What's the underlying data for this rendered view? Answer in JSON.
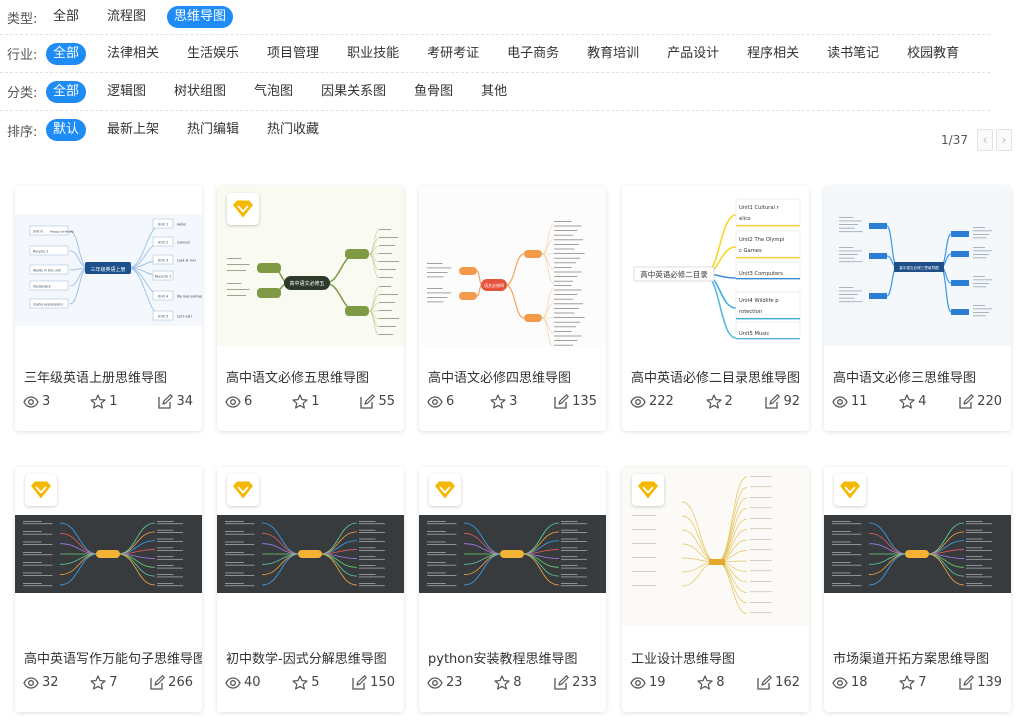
{
  "filters": {
    "type": {
      "label": "类型:",
      "options": [
        "全部",
        "流程图",
        "思维导图"
      ],
      "active": 2
    },
    "industry": {
      "label": "行业:",
      "options": [
        "全部",
        "法律相关",
        "生活娱乐",
        "项目管理",
        "职业技能",
        "考研考证",
        "电子商务",
        "教育培训",
        "产品设计",
        "程序相关",
        "读书笔记",
        "校园教育"
      ],
      "active": 0
    },
    "category": {
      "label": "分类:",
      "options": [
        "全部",
        "逻辑图",
        "树状组图",
        "气泡图",
        "因果关系图",
        "鱼骨图",
        "其他"
      ],
      "active": 0
    },
    "sort": {
      "label": "排序:",
      "options": [
        "默认",
        "最新上架",
        "热门编辑",
        "热门收藏"
      ],
      "active": 0
    }
  },
  "pager": {
    "text": "1/37",
    "prev": "‹",
    "next": "›"
  },
  "colors": {
    "accent": "#1f8cf5",
    "badge": "#f5b800",
    "dark_thumb": "#373b3e"
  },
  "cards": [
    {
      "title": "三年级英语上册思维导图",
      "views": "3",
      "stars": "1",
      "edits": "34",
      "premium": false,
      "style": "light",
      "texts": [
        "三年级英语上册",
        "Unit 1",
        "Hello!",
        "Unit 2",
        "Colours!",
        "Unit 3",
        "Look at me!",
        "Recycle 1",
        "Unit 4",
        "We love animals",
        "Unit 5",
        "Let's eat!",
        "Unit 6",
        "Happy birthday!",
        "Recycle 2",
        "Words in this unit",
        "Vocabulary",
        "Useful expressions"
      ]
    },
    {
      "title": "高中语文必修五思维导图",
      "views": "6",
      "stars": "1",
      "edits": "55",
      "premium": true,
      "style": "green",
      "texts": [
        "高中语文必修五"
      ]
    },
    {
      "title": "高中语文必修四思维导图",
      "views": "6",
      "stars": "3",
      "edits": "135",
      "premium": false,
      "style": "orange",
      "texts": [
        "语文必修四"
      ]
    },
    {
      "title": "高中英语必修二目录思维导图",
      "views": "222",
      "stars": "2",
      "edits": "92",
      "premium": false,
      "style": "english",
      "texts": [
        "高中英语必修二目录",
        "Unit1 Cultural relics",
        "Unit2 The Olympic Games",
        "Unit3 Computers",
        "Unit4 Wildlife protection",
        "Unit5 Music"
      ]
    },
    {
      "title": "高中语文必修三思维导图",
      "views": "11",
      "stars": "4",
      "edits": "220",
      "premium": false,
      "style": "blue",
      "texts": [
        "高中语文必修三思维导图"
      ]
    },
    {
      "title": "高中英语写作万能句子思维导图",
      "views": "32",
      "stars": "7",
      "edits": "266",
      "premium": true,
      "style": "dark"
    },
    {
      "title": "初中数学-因式分解思维导图",
      "views": "40",
      "stars": "5",
      "edits": "150",
      "premium": true,
      "style": "dark"
    },
    {
      "title": "python安装教程思维导图",
      "views": "23",
      "stars": "8",
      "edits": "233",
      "premium": true,
      "style": "dark"
    },
    {
      "title": "工业设计思维导图",
      "views": "19",
      "stars": "8",
      "edits": "162",
      "premium": true,
      "style": "beige"
    },
    {
      "title": "市场渠道开拓方案思维导图",
      "views": "18",
      "stars": "7",
      "edits": "139",
      "premium": true,
      "style": "dark"
    }
  ]
}
